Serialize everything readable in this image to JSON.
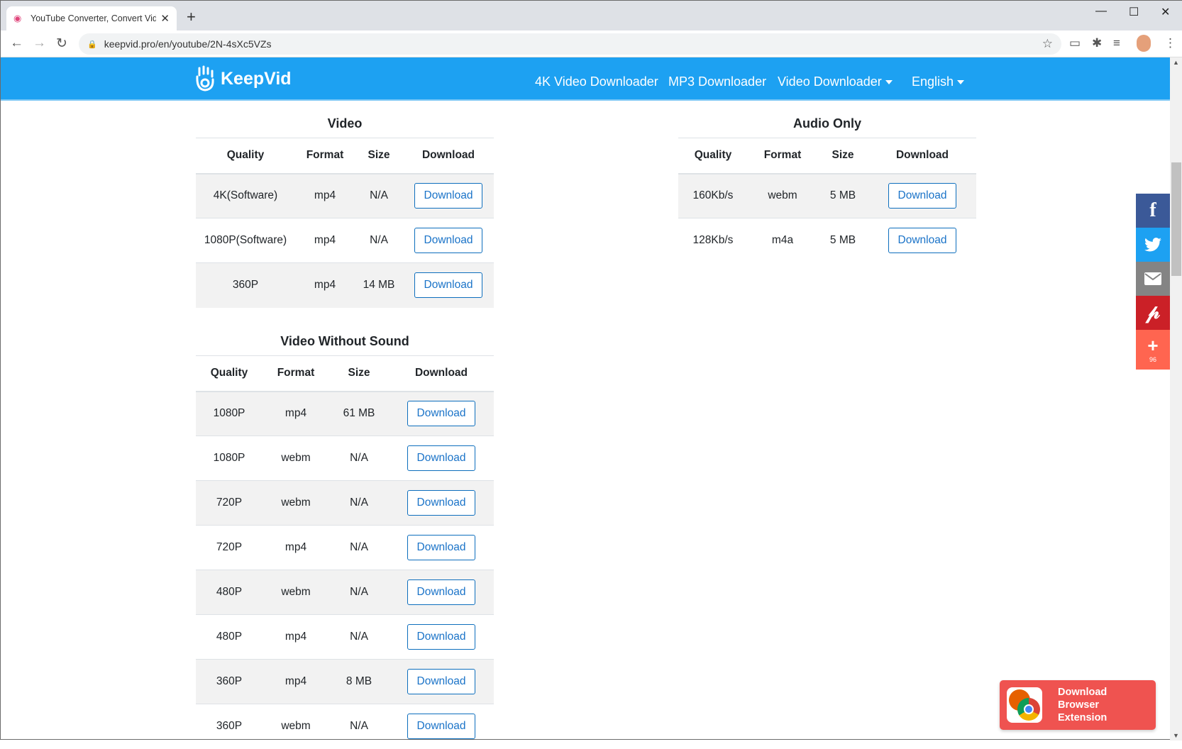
{
  "browser": {
    "tab_title": "YouTube Converter, Convert Vide",
    "url": "keepvid.pro/en/youtube/2N-4sXc5VZs"
  },
  "header": {
    "logo": "KeepVid",
    "nav": [
      "4K Video Downloader",
      "MP3 Downloader",
      "Video Downloader",
      "English"
    ]
  },
  "video": {
    "title": "Video",
    "columns": [
      "Quality",
      "Format",
      "Size",
      "Download"
    ],
    "rows": [
      [
        "4K(Software)",
        "mp4",
        "N/A",
        "Download"
      ],
      [
        "1080P(Software)",
        "mp4",
        "N/A",
        "Download"
      ],
      [
        "360P",
        "mp4",
        "14 MB",
        "Download"
      ]
    ]
  },
  "audio": {
    "title": "Audio Only",
    "columns": [
      "Quality",
      "Format",
      "Size",
      "Download"
    ],
    "rows": [
      [
        "160Kb/s",
        "webm",
        "5 MB",
        "Download"
      ],
      [
        "128Kb/s",
        "m4a",
        "5 MB",
        "Download"
      ]
    ]
  },
  "nosound": {
    "title": "Video Without Sound",
    "columns": [
      "Quality",
      "Format",
      "Size",
      "Download"
    ],
    "rows": [
      [
        "1080P",
        "mp4",
        "61 MB",
        "Download"
      ],
      [
        "1080P",
        "webm",
        "N/A",
        "Download"
      ],
      [
        "720P",
        "webm",
        "N/A",
        "Download"
      ],
      [
        "720P",
        "mp4",
        "N/A",
        "Download"
      ],
      [
        "480P",
        "webm",
        "N/A",
        "Download"
      ],
      [
        "480P",
        "mp4",
        "N/A",
        "Download"
      ],
      [
        "360P",
        "mp4",
        "8 MB",
        "Download"
      ],
      [
        "360P",
        "webm",
        "N/A",
        "Download"
      ]
    ]
  },
  "social": {
    "share_count": "96",
    "colors": {
      "facebook": "#3b5998",
      "twitter": "#1da1f2",
      "email": "#848484",
      "pinterest": "#cb2027",
      "more": "#ff6550"
    }
  },
  "extension_banner": {
    "label": "Download Browser Extension"
  }
}
